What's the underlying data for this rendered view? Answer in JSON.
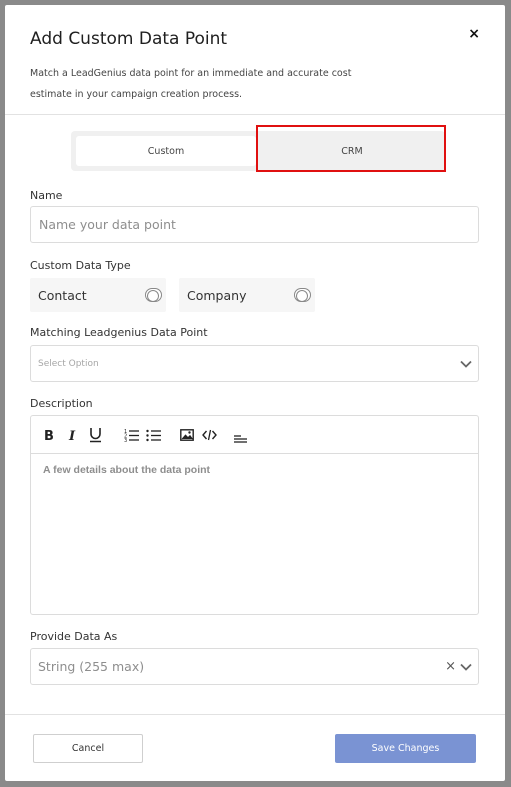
{
  "modal": {
    "title": "Add Custom Data Point",
    "subtitle": "Match a LeadGenius data point for an immediate and accurate cost estimate in your campaign creation process.",
    "close_glyph": "×"
  },
  "segmented": {
    "custom_label": "Custom",
    "crm_label": "CRM"
  },
  "name_field": {
    "label": "Name",
    "placeholder": "Name your data point",
    "value": ""
  },
  "data_type": {
    "label": "Custom Data Type",
    "options": [
      "Contact",
      "Company"
    ]
  },
  "matching": {
    "label": "Matching Leadgenius Data Point",
    "placeholder": "Select Option"
  },
  "description": {
    "label": "Description",
    "placeholder": "A few details about the data point",
    "toolbar_icons": [
      "bold-icon",
      "italic-icon",
      "underline-icon",
      "ordered-list-icon",
      "bullet-list-icon",
      "image-icon",
      "code-icon",
      "align-icon"
    ]
  },
  "provide_as": {
    "label": "Provide Data As",
    "value": "String (255 max)"
  },
  "footer": {
    "cancel_label": "Cancel",
    "save_label": "Save Changes"
  },
  "colors": {
    "primary_button": "#7a93d3",
    "highlight": "#e01010"
  }
}
